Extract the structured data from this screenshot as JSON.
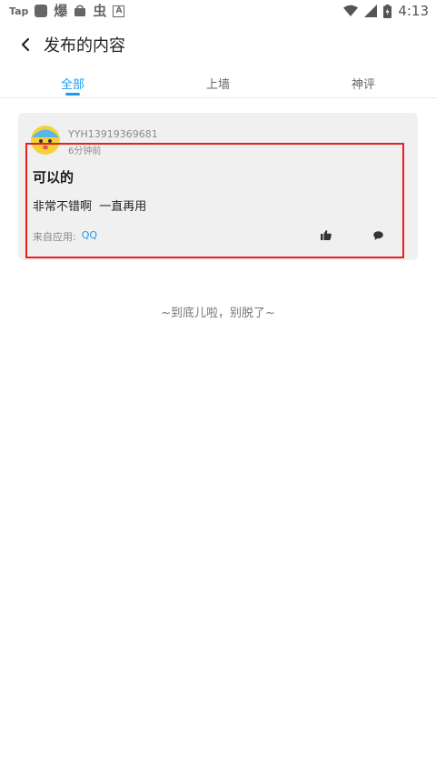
{
  "status_bar": {
    "tap_label": "Tap",
    "glyph1": "爆",
    "glyph2": "虫",
    "glyph3": "A",
    "time": "4:13",
    "icons": [
      "wifi-icon",
      "cell-signal-icon",
      "battery-icon"
    ]
  },
  "header": {
    "title": "发布的内容"
  },
  "tabs": [
    {
      "label": "全部",
      "active": true
    },
    {
      "label": "上墙",
      "active": false
    },
    {
      "label": "神评",
      "active": false
    }
  ],
  "post": {
    "username": "YYH13919369681",
    "time": "6分钟前",
    "title": "可以的",
    "body": "非常不错啊  一直再用",
    "source_label": "来自应用:",
    "source_app": "QQ"
  },
  "footer": {
    "end_text": "~到底儿啦，别脱了~"
  },
  "colors": {
    "accent": "#1a9cf0",
    "highlight": "#e8201c",
    "card_bg": "#f0f0f0"
  }
}
